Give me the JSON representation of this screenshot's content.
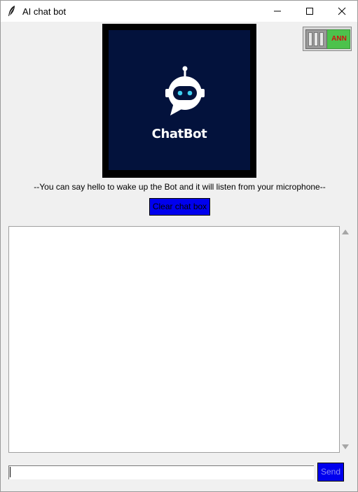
{
  "window": {
    "title": "AI chat bot",
    "controls": {
      "minimize_icon": "minimize-icon",
      "maximize_icon": "maximize-icon",
      "close_icon": "close-icon"
    }
  },
  "logo": {
    "text": "ChatBot",
    "background": "#03123c",
    "eye_color": "#3fd0f0"
  },
  "toggle": {
    "label": "ANN",
    "state": "on",
    "on_color": "#4cc24c",
    "label_color": "#d01010"
  },
  "hint_text": "--You can say hello to wake up the Bot and it will listen from your microphone--",
  "clear_button": {
    "label": "Clear chat box",
    "color": "#0000ee"
  },
  "chat": {
    "messages": []
  },
  "input": {
    "value": "",
    "placeholder": ""
  },
  "send_button": {
    "label": "Send",
    "color": "#0000ee"
  }
}
